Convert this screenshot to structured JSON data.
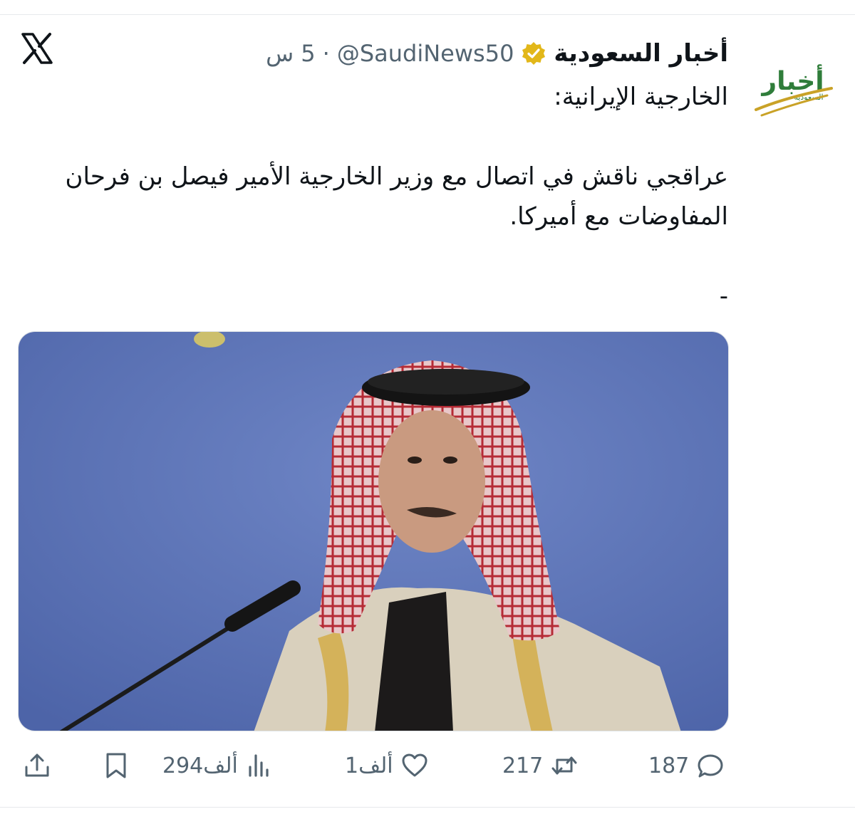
{
  "account": {
    "display_name": "أخبار السعودية",
    "handle": "@SaudiNews50",
    "separator": "·",
    "timestamp": "5 س",
    "avatar_text": "أخبار",
    "avatar_subtext": "السعودية",
    "verified_icon": "verified-badge-icon"
  },
  "tweet": {
    "line1": "الخارجية الإيرانية:",
    "line2": "عراقجي ناقش في اتصال مع وزير الخارجية الأمير فيصل بن فرحان المفاوضات مع أميركا.",
    "line3": "-"
  },
  "actions": {
    "reply_count": "187",
    "retweet_count": "217",
    "like_count": "1ألف",
    "views_count": "294ألف"
  },
  "colors": {
    "text_primary": "#0f1419",
    "text_secondary": "#536471",
    "verified_gold": "#e2b719",
    "logo_green": "#2f7d3a",
    "logo_gold": "#c9a227"
  }
}
